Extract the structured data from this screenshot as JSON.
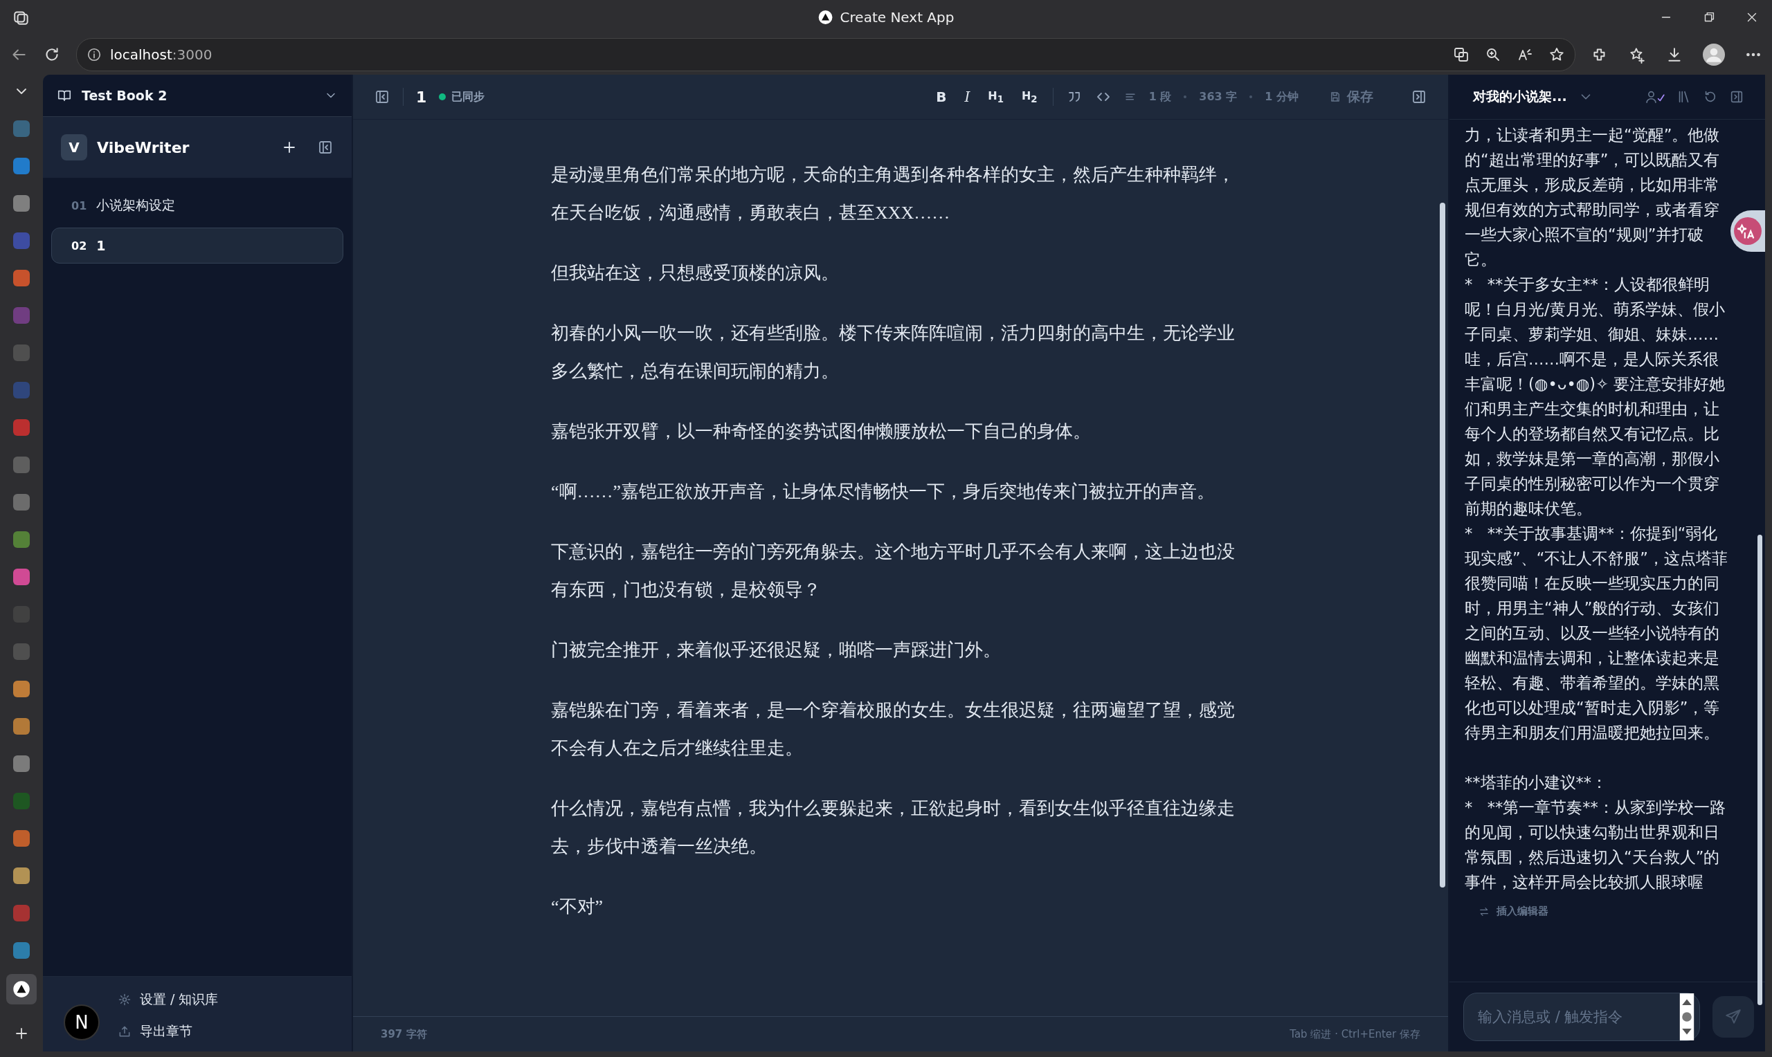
{
  "browser": {
    "title": "Create Next App",
    "url_host": "localhost",
    "url_port": ":3000"
  },
  "book": {
    "title": "Test Book 2"
  },
  "brand": {
    "logo": "V",
    "name": "VibeWriter"
  },
  "chapters": [
    {
      "number": "01",
      "title": "小说架构设定",
      "selected": false
    },
    {
      "number": "02",
      "title": "1",
      "selected": true
    }
  ],
  "sidebar_footer": [
    {
      "kind": "settings",
      "label": "设置 / 知识库"
    },
    {
      "kind": "export",
      "label": "导出章节"
    }
  ],
  "dev_badge": "N",
  "editor": {
    "chapter": "1",
    "sync": {
      "synced": true,
      "label": "已同步"
    },
    "format_buttons": [
      {
        "kind": "bold",
        "label": "B"
      },
      {
        "kind": "italic",
        "label": "I"
      },
      {
        "kind": "heading",
        "label": "H$_{1}$"
      },
      {
        "kind": "heading",
        "label": "H$_{2}$"
      }
    ],
    "stats": [
      "1 段",
      "363 字",
      "1 分钟"
    ],
    "save": "保存",
    "paragraphs": [
      "是动漫里角色们常呆的地方呢，天命的主角遇到各种各样的女主，然后产生种种羁绊，在天台吃饭，沟通感情，勇敢表白，甚至XXX……",
      "但我站在这，只想感受顶楼的凉风。",
      "初春的小风一吹一吹，还有些刮脸。楼下传来阵阵喧闹，活力四射的高中生，无论学业多么繁忙，总有在课间玩闹的精力。",
      "嘉铠张开双臂，以一种奇怪的姿势试图伸懒腰放松一下自己的身体。",
      "“啊……”嘉铠正欲放开声音，让身体尽情畅快一下，身后突地传来门被拉开的声音。",
      "下意识的，嘉铠往一旁的门旁死角躲去。这个地方平时几乎不会有人来啊，这上边也没有东西，门也没有锁，是校领导？",
      "门被完全推开，来着似乎还很迟疑，啪嗒一声踩进门外。",
      "嘉铠躲在门旁，看着来者，是一个穿着校服的女生。女生很迟疑，往两遍望了望，感觉不会有人在之后才继续往里走。",
      "什么情况，嘉铠有点懵，我为什么要躲起来，正欲起身时，看到女生似乎径直往边缘走去，步伐中透着一丝决绝。",
      "“不对”"
    ],
    "char_count": "397 字符",
    "hint": "Tab 缩进 · Ctrl+Enter 保存"
  },
  "chat": {
    "title": "对我的小说架...",
    "paragraphs": [
      "力，让读者和男主一起“觉醒”。他做的“超出常理的好事”，可以既酷又有点无厘头，形成反差萌，比如用非常规但有效的方式帮助同学，或者看穿一些大家心照不宣的“规则”并打破它。",
      "*   **关于多女主**：人设都很鲜明呢！白月光/黄月光、萌系学妹、假小子同桌、萝莉学姐、御姐、妹妹……哇，后宫……啊不是，是人际关系很丰富呢！(◍•ᴗ•◍)✧ 要注意安排好她们和男主产生交集的时机和理由，让每个人的登场都自然又有记忆点。比如，救学妹是第一章的高潮，那假小子同桌的性别秘密可以作为一个贯穿前期的趣味伏笔。",
      "*   **关于故事基调**：你提到“弱化现实感”、“不让人不舒服”，这点塔菲很赞同喵！在反映一些现实压力的同时，用男主“神人”般的行动、女孩们之间的互动、以及一些轻小说特有的幽默和温情去调和，让整体读起来是轻松、有趣、带着希望的。学妹的黑化也可以处理成“暂时走入阴影”，等待男主和朋友们用温暖把她拉回来。",
      "**塔菲的小建议**：",
      "*   **第一章节奏**：从家到学校一路的见闻，可以快速勾勒出世界观和日常氛围，然后迅速切入“天台救人”的事件，这样开局会比较抓人眼球喔"
    ],
    "insert": "插入编辑器",
    "placeholder": "输入消息或 / 触发指令"
  }
}
